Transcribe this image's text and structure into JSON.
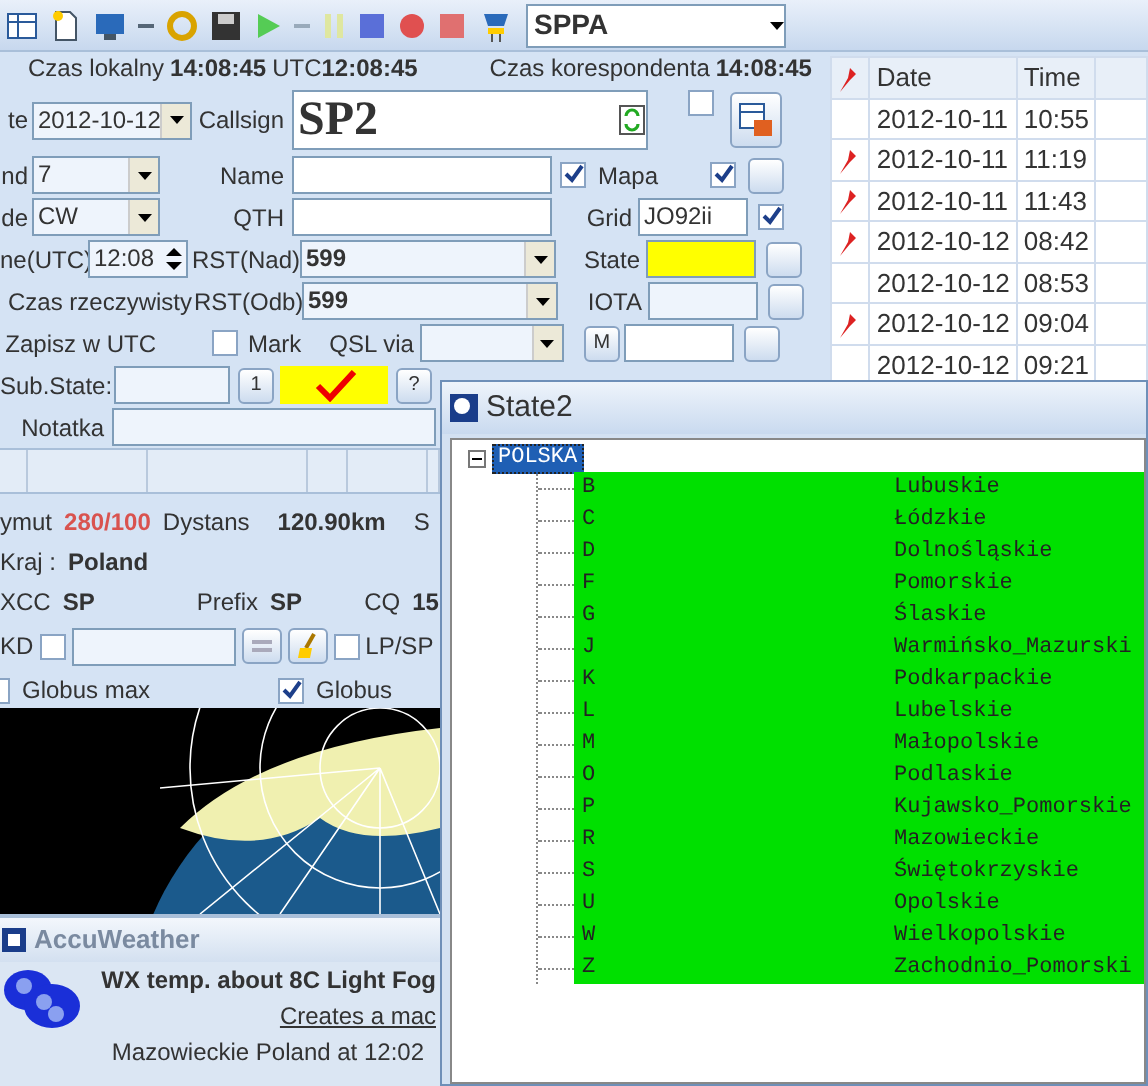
{
  "toolbar": {
    "profile": "SPPA"
  },
  "clock_bar": {
    "local_label": "Czas lokalny",
    "local_time": "14:08:45",
    "utc_label": "UTC",
    "utc_time": "12:08:45",
    "corr_label": "Czas korespondenta",
    "corr_time": "14:08:45"
  },
  "form": {
    "date_label": "te",
    "date": "2012-10-12",
    "band_label": "nd",
    "band": "7",
    "mode_label": "de",
    "mode": "CW",
    "time_label": "ne(UTC)",
    "time": "12:08",
    "realtime_label": "Czas rzeczywisty",
    "save_utc_label": "Zapisz w UTC",
    "callsign_label": "Callsign",
    "callsign": "SP2",
    "lock_checked": false,
    "name_label": "Name",
    "name_checked": true,
    "qth_label": "QTH",
    "rst_sent_label": "RST(Nad)",
    "rst_sent": "599",
    "rst_rcvd_label": "RST(Odb)",
    "rst_rcvd": "599",
    "mark_label": "Mark",
    "mark_checked": false,
    "qsl_via_label": "QSL via",
    "map_label": "Mapa",
    "map_checked": true,
    "grid_label": "Grid",
    "grid": "JO92ii",
    "grid_checked": true,
    "state_label": "State",
    "iota_label": "IOTA",
    "m_button": "M",
    "substate_label": "Sub.State:",
    "one_button": "1",
    "substate_confirmed": true,
    "help_button": "?",
    "note_label": "Notatka"
  },
  "info": {
    "azimuth_label": "ymut",
    "azimuth": "280/100",
    "distance_label": "Dystans",
    "distance": "120.90km",
    "cut_label": "S",
    "country_label": "Kraj :",
    "country": "Poland",
    "dxcc_label": "XCC",
    "dxcc": "SP",
    "prefix_label": "Prefix",
    "prefix": "SP",
    "cq_label": "CQ",
    "cq": "15",
    "kd_label": "KD",
    "kd_checked": false,
    "lpsp_label": "LP/SP",
    "lpsp_checked": false,
    "globe_max_label": "Globus max",
    "globe_max_checked": false,
    "globe_label": "Globus",
    "globe_checked": true
  },
  "weather": {
    "title": "AccuWeather",
    "headline": "WX temp. about 8C Light Fog",
    "link": "Creates a mac",
    "location": "Mazowieckie Poland at 12:02"
  },
  "log": {
    "columns": [
      "Date",
      "Time"
    ],
    "rows": [
      {
        "date": "2012-10-11",
        "time": "10:55",
        "pinned": false
      },
      {
        "date": "2012-10-11",
        "time": "11:19",
        "pinned": true
      },
      {
        "date": "2012-10-11",
        "time": "11:43",
        "pinned": true
      },
      {
        "date": "2012-10-12",
        "time": "08:42",
        "pinned": true
      },
      {
        "date": "2012-10-12",
        "time": "08:53",
        "pinned": false
      },
      {
        "date": "2012-10-12",
        "time": "09:04",
        "pinned": true
      },
      {
        "date": "2012-10-12",
        "time": "09:21",
        "pinned": false
      }
    ]
  },
  "state_window": {
    "title": "State2",
    "tree": [
      {
        "label": "POLSKA",
        "selected": true,
        "expanded": true,
        "children": [
          {
            "code": "B",
            "name": "Lubuskie"
          },
          {
            "code": "C",
            "name": "Łódzkie"
          },
          {
            "code": "D",
            "name": "Dolnośląskie"
          },
          {
            "code": "F",
            "name": "Pomorskie"
          },
          {
            "code": "G",
            "name": "Ślaskie"
          },
          {
            "code": "J",
            "name": "Warmińsko_Mazurski"
          },
          {
            "code": "K",
            "name": "Podkarpackie"
          },
          {
            "code": "L",
            "name": "Lubelskie"
          },
          {
            "code": "M",
            "name": "Małopolskie"
          },
          {
            "code": "O",
            "name": "Podlaskie"
          },
          {
            "code": "P",
            "name": "Kujawsko_Pomorskie"
          },
          {
            "code": "R",
            "name": "Mazowieckie"
          },
          {
            "code": "S",
            "name": "Świętokrzyskie"
          },
          {
            "code": "U",
            "name": "Opolskie"
          },
          {
            "code": "W",
            "name": "Wielkopolskie"
          },
          {
            "code": "Z",
            "name": "Zachodnio_Pomorski"
          }
        ]
      }
    ]
  }
}
